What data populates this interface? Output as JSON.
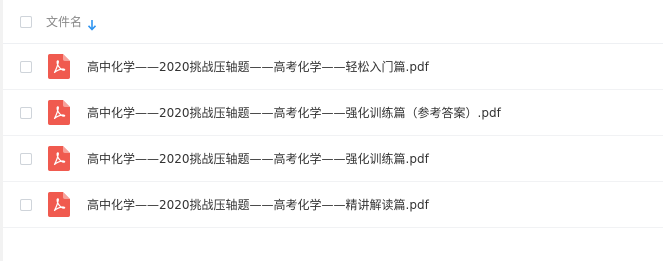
{
  "header": {
    "column_label": "文件名",
    "sort_icon": "arrow-down-icon",
    "accent_color": "#2e94f0"
  },
  "files": [
    {
      "name": "高中化学——2020挑战压轴题——高考化学——轻松入门篇.pdf",
      "icon": "pdf-icon"
    },
    {
      "name": "高中化学——2020挑战压轴题——高考化学——强化训练篇（参考答案）.pdf",
      "icon": "pdf-icon"
    },
    {
      "name": "高中化学——2020挑战压轴题——高考化学——强化训练篇.pdf",
      "icon": "pdf-icon"
    },
    {
      "name": "高中化学——2020挑战压轴题——高考化学——精讲解读篇.pdf",
      "icon": "pdf-icon"
    }
  ],
  "colors": {
    "pdf_icon": "#f05a4f",
    "text": "#333333",
    "header_text": "#888888"
  }
}
